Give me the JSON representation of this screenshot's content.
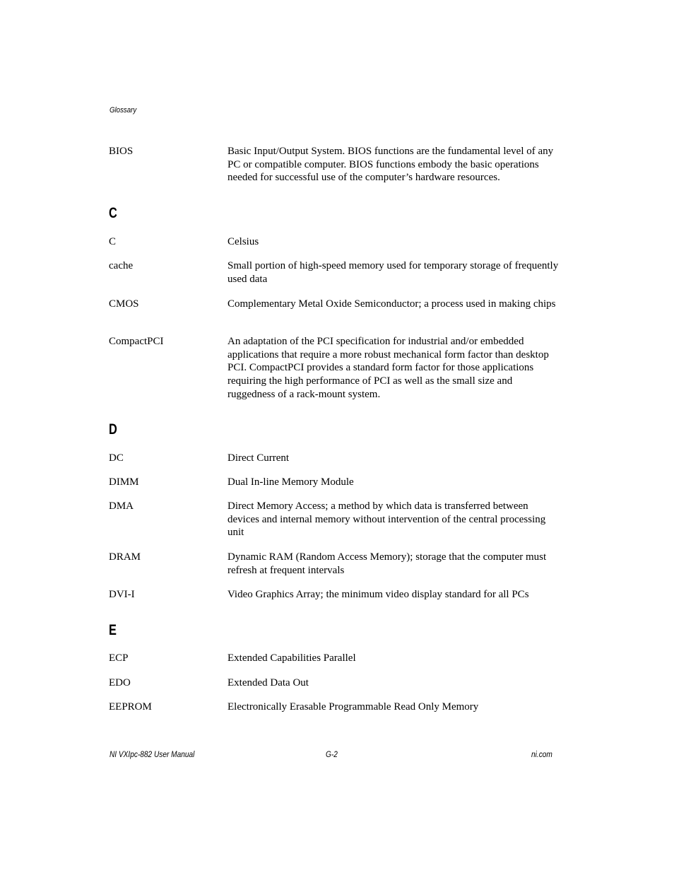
{
  "header": {
    "running_title": "Glossary"
  },
  "sections": [
    {
      "letter": "",
      "entries": [
        {
          "term": "BIOS",
          "definition": "Basic Input/Output System. BIOS functions are the fundamental level of any PC or compatible computer. BIOS functions embody the basic operations needed for successful use of the computer’s hardware resources."
        }
      ]
    },
    {
      "letter": "C",
      "entries": [
        {
          "term": "C",
          "definition": "Celsius"
        },
        {
          "term": "cache",
          "definition": "Small portion of high-speed memory used for temporary storage of frequently used data"
        },
        {
          "term": "CMOS",
          "definition": "Complementary Metal Oxide Semiconductor; a process used in making chips"
        },
        {
          "term": "CompactPCI",
          "definition": "An adaptation of the PCI specification for industrial and/or embedded applications that require a more robust mechanical form factor than desktop PCI. CompactPCI provides a standard form factor for those applications requiring the high performance of PCI as well as the small size and ruggedness of a rack-mount system."
        }
      ]
    },
    {
      "letter": "D",
      "entries": [
        {
          "term": "DC",
          "definition": "Direct Current"
        },
        {
          "term": "DIMM",
          "definition": "Dual In-line Memory Module"
        },
        {
          "term": "DMA",
          "definition": "Direct Memory Access; a method by which data is transferred between devices and internal memory without intervention of the central processing unit"
        },
        {
          "term": "DRAM",
          "definition": "Dynamic RAM (Random Access Memory); storage that the computer must refresh at frequent intervals"
        },
        {
          "term": "DVI-I",
          "definition": "Video Graphics Array; the minimum video display standard for all PCs"
        }
      ]
    },
    {
      "letter": "E",
      "entries": [
        {
          "term": "ECP",
          "definition": "Extended Capabilities Parallel"
        },
        {
          "term": "EDO",
          "definition": "Extended Data Out"
        },
        {
          "term": "EEPROM",
          "definition": "Electronically Erasable Programmable Read Only Memory"
        }
      ]
    }
  ],
  "footer": {
    "manual_title": "NI VXIpc-882 User Manual",
    "page_number": "G-2",
    "website": "ni.com"
  }
}
